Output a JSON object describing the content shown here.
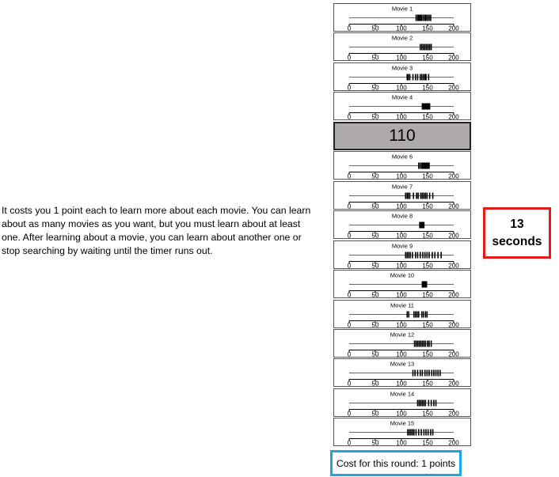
{
  "instructions": "It costs you 1 point each to learn more about each movie. You can learn about as many movies as you want, but you must learn about at least one. After learning about a movie, you can learn about another one or stop searching by waiting until the timer runs out.",
  "axis_ticks": [
    "0",
    "50",
    "100",
    "150",
    "200"
  ],
  "axis_range": [
    0,
    200
  ],
  "movies": [
    {
      "label": "Movie 1",
      "ratings": [
        128,
        131,
        133,
        135,
        137,
        139,
        142,
        145,
        147,
        150,
        153,
        156
      ]
    },
    {
      "label": "Movie 2",
      "ratings": [
        136,
        139,
        142,
        145,
        148,
        151,
        154,
        157
      ]
    },
    {
      "label": "Movie 3",
      "ratings": [
        111,
        113,
        116,
        122,
        127,
        131,
        136,
        139,
        142,
        145,
        147,
        152
      ]
    },
    {
      "label": "Movie 4",
      "ratings": [
        140,
        142,
        144,
        146,
        148,
        150,
        152,
        154
      ]
    },
    {
      "label": "Movie 5",
      "revealed": true,
      "value": "110"
    },
    {
      "label": "Movie 6",
      "ratings": [
        133,
        136,
        139,
        141,
        143,
        145,
        147,
        149,
        151,
        153
      ]
    },
    {
      "label": "Movie 7",
      "ratings": [
        108,
        111,
        113,
        116,
        123,
        129,
        132,
        137,
        140,
        143,
        146,
        149,
        154,
        160
      ]
    },
    {
      "label": "Movie 8",
      "ratings": [
        135,
        137,
        139,
        141,
        143
      ]
    },
    {
      "label": "Movie 9",
      "ratings": [
        108,
        111,
        114,
        117,
        121,
        127,
        131,
        136,
        141,
        145,
        149,
        153,
        159,
        164,
        170,
        176
      ]
    },
    {
      "label": "Movie 10",
      "ratings": [
        140,
        142,
        144,
        146,
        148
      ]
    },
    {
      "label": "Movie 11",
      "ratings": [
        111,
        114,
        124,
        127,
        130,
        133,
        139,
        142,
        146,
        149
      ]
    },
    {
      "label": "Movie 12",
      "ratings": [
        125,
        128,
        131,
        134,
        137,
        140,
        143,
        146,
        150,
        153,
        157
      ]
    },
    {
      "label": "Movie 13",
      "ratings": [
        122,
        126,
        131,
        136,
        140,
        145,
        149,
        153,
        158,
        162,
        166,
        170,
        174
      ]
    },
    {
      "label": "Movie 14",
      "ratings": [
        131,
        134,
        137,
        140,
        143,
        146,
        152,
        157,
        162,
        166
      ]
    },
    {
      "label": "Movie 15",
      "ratings": [
        112,
        115,
        118,
        121,
        124,
        128,
        133,
        138,
        143,
        147,
        151,
        156,
        160
      ]
    }
  ],
  "timer": {
    "value": "13",
    "unit": "seconds",
    "color": "#e41b17"
  },
  "cost": {
    "text": "Cost for this round: 1 points",
    "color": "#1ea5e0"
  }
}
